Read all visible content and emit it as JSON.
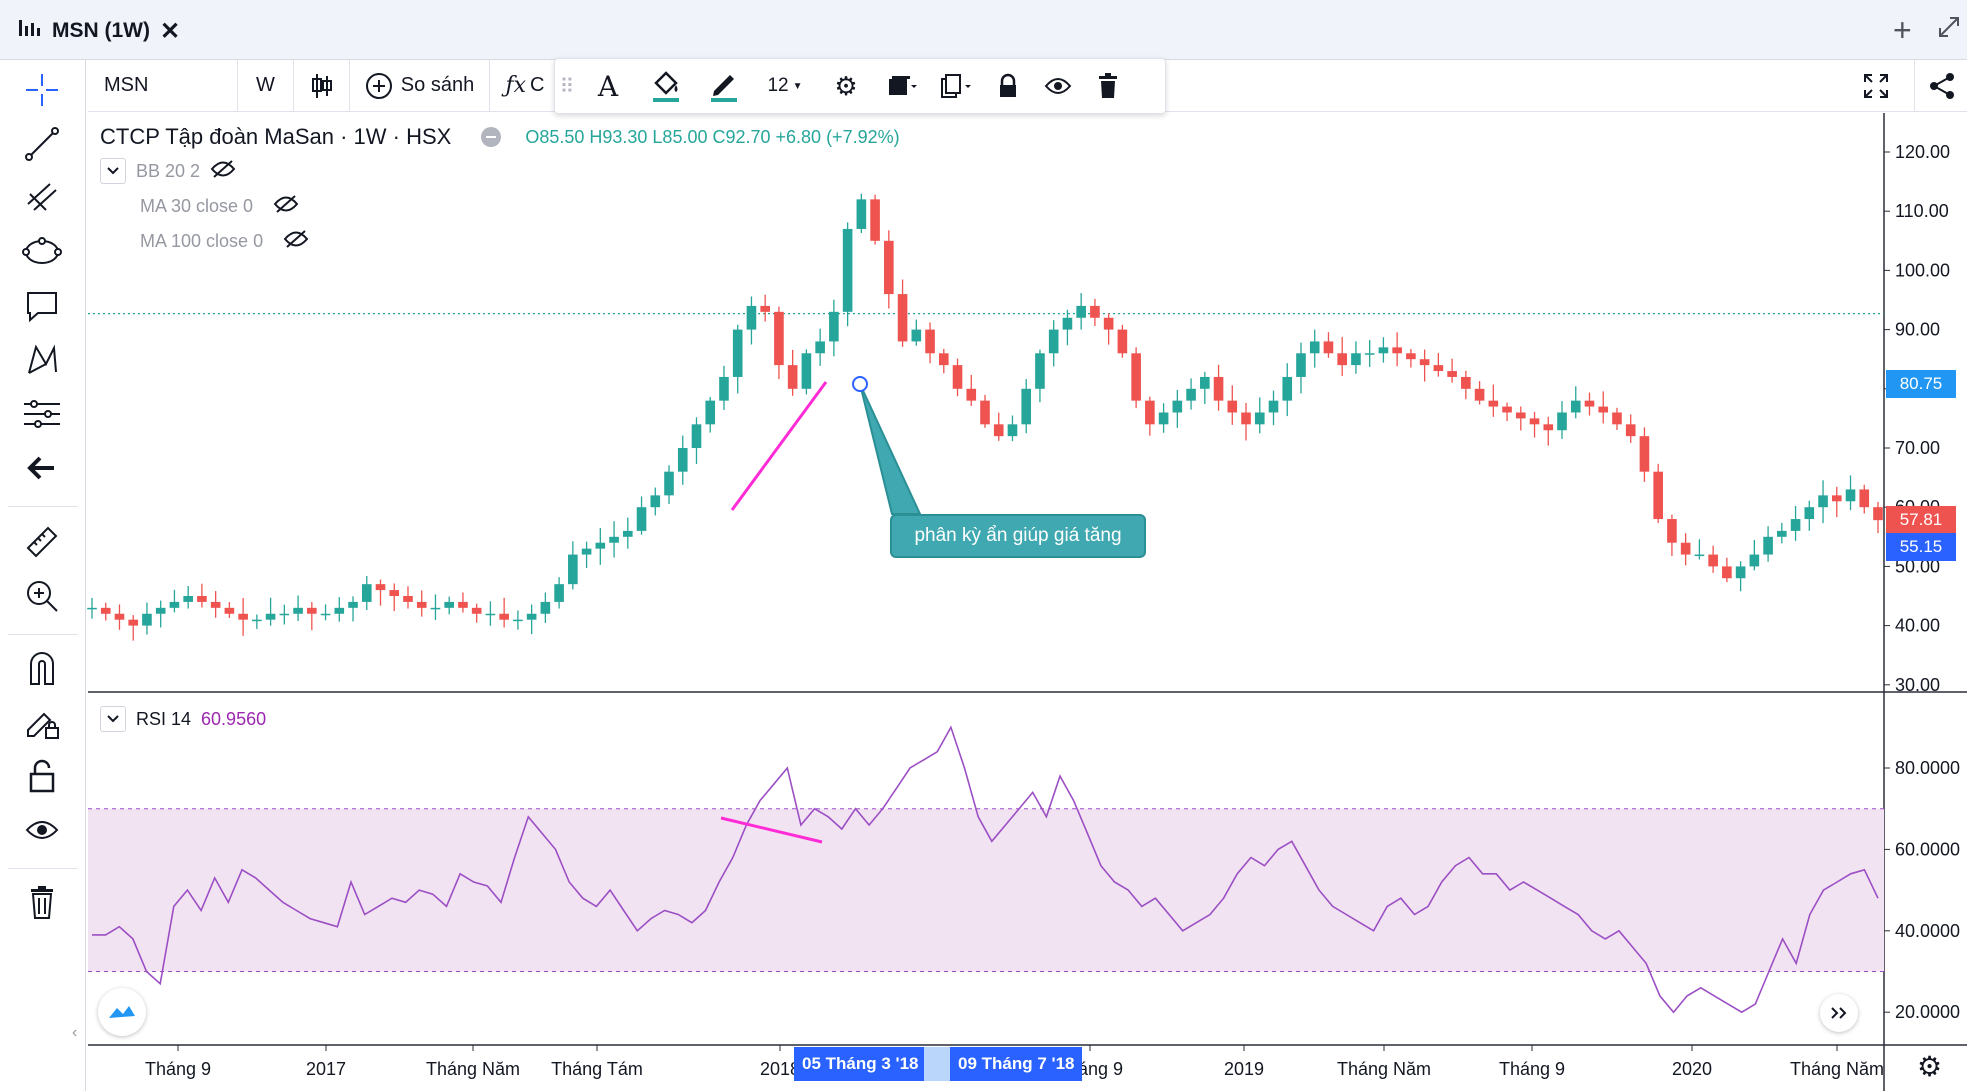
{
  "tab": {
    "title": "MSN (1W)"
  },
  "toolbar": {
    "symbol": "MSN",
    "interval": "W",
    "compare_label": "So sánh",
    "indicators_partial": "C",
    "font_size": "12"
  },
  "legend": {
    "title": "CTCP Tập đoàn MaSan · 1W · HSX",
    "ohlc": "O85.50 H93.30 L85.00 C92.70 +6.80 (+7.92%)",
    "indicators": [
      "BB 20 2",
      "MA 30 close 0",
      "MA 100 close 0"
    ]
  },
  "rsi_legend": {
    "name": "RSI 14",
    "value": "60.9560"
  },
  "annotation": {
    "text": "phân kỳ ẩn giúp giá tăng"
  },
  "price_badges": {
    "current": "80.75",
    "last": "57.81",
    "low": "55.15"
  },
  "x_badges": {
    "start": "05 Tháng 3 '18",
    "end": "09 Tháng 7 '18"
  },
  "colors": {
    "up": "#26a69a",
    "down": "#ef5350",
    "rsi_line": "#9c4fc5",
    "rsi_band": "#f1e3f1",
    "trend_line": "#ff2bd6",
    "accent": "#2962ff"
  },
  "icons": [
    "crosshair-icon",
    "trendline-icon",
    "fib-icon",
    "shape-icon",
    "text-icon",
    "pattern-icon",
    "measure-tool-icon",
    "back-arrow-icon",
    "ruler-icon",
    "zoom-icon",
    "magnet-icon",
    "lock-drawing-icon",
    "unlock-icon",
    "eye-icon",
    "trash-icon"
  ],
  "chart_data": [
    {
      "type": "candlestick",
      "ylim": [
        30,
        125
      ],
      "y_ticks": [
        "120.00",
        "110.00",
        "100.00",
        "90.00",
        "80.00",
        "70.00",
        "60.00",
        "50.00",
        "40.00",
        "30.00"
      ],
      "x_ticks": [
        "Tháng 9",
        "2017",
        "Tháng Năm",
        "Tháng Tám",
        "2018",
        "Tháng 9",
        "2019",
        "Tháng Năm",
        "Tháng 9",
        "2020",
        "Tháng Năm"
      ],
      "series": [
        {
          "values": [
            43,
            42,
            41,
            40,
            42,
            43,
            44,
            45,
            44,
            43,
            42,
            41,
            41,
            42,
            42,
            43,
            42,
            42,
            43,
            44,
            47,
            46,
            45,
            44,
            43,
            43,
            44,
            43,
            42,
            42,
            41,
            41,
            42,
            44,
            47,
            52,
            53,
            54,
            55,
            56,
            60,
            62,
            66,
            70,
            74,
            78,
            82,
            90,
            94,
            93,
            84,
            80,
            86,
            88,
            93,
            107,
            112,
            105,
            96,
            88,
            90,
            86,
            84,
            80,
            78,
            74,
            72,
            74,
            80,
            86,
            90,
            92,
            94,
            92,
            90,
            86,
            78,
            74,
            76,
            78,
            80,
            82,
            78,
            76,
            74,
            76,
            78,
            82,
            86,
            88,
            86,
            84,
            86,
            86,
            87,
            86,
            85,
            84,
            83,
            82,
            80,
            78,
            77,
            76,
            75,
            74,
            73,
            76,
            78,
            77,
            76,
            74,
            72,
            66,
            58,
            54,
            52,
            52,
            50,
            48,
            50,
            52,
            55,
            56,
            58,
            60,
            62,
            61,
            63,
            60,
            57.81
          ]
        }
      ],
      "horizontal_line": 92.7
    },
    {
      "type": "line",
      "name": "RSI 14",
      "ylim": [
        10,
        95
      ],
      "y_ticks": [
        "80.0000",
        "60.0000",
        "40.0000",
        "20.0000"
      ],
      "bands": [
        30,
        70
      ],
      "series": [
        {
          "values": [
            39,
            39,
            41,
            38,
            30,
            27,
            46,
            50,
            45,
            53,
            47,
            55,
            53,
            50,
            47,
            45,
            43,
            42,
            41,
            52,
            44,
            46,
            48,
            47,
            50,
            49,
            46,
            54,
            52,
            51,
            47,
            58,
            68,
            64,
            60,
            52,
            48,
            46,
            50,
            45,
            40,
            43,
            45,
            44,
            42,
            45,
            52,
            58,
            66,
            72,
            76,
            80,
            66,
            70,
            68,
            65,
            70,
            66,
            70,
            75,
            80,
            82,
            84,
            90,
            80,
            68,
            62,
            66,
            70,
            74,
            68,
            78,
            72,
            64,
            56,
            52,
            50,
            46,
            48,
            44,
            40,
            42,
            44,
            48,
            54,
            58,
            56,
            60,
            62,
            56,
            50,
            46,
            44,
            42,
            40,
            46,
            48,
            44,
            46,
            52,
            56,
            58,
            54,
            54,
            50,
            52,
            50,
            48,
            46,
            44,
            40,
            38,
            40,
            36,
            32,
            24,
            20,
            24,
            26,
            24,
            22,
            20,
            22,
            30,
            38,
            32,
            44,
            50,
            52,
            54,
            55,
            48
          ]
        }
      ]
    }
  ]
}
